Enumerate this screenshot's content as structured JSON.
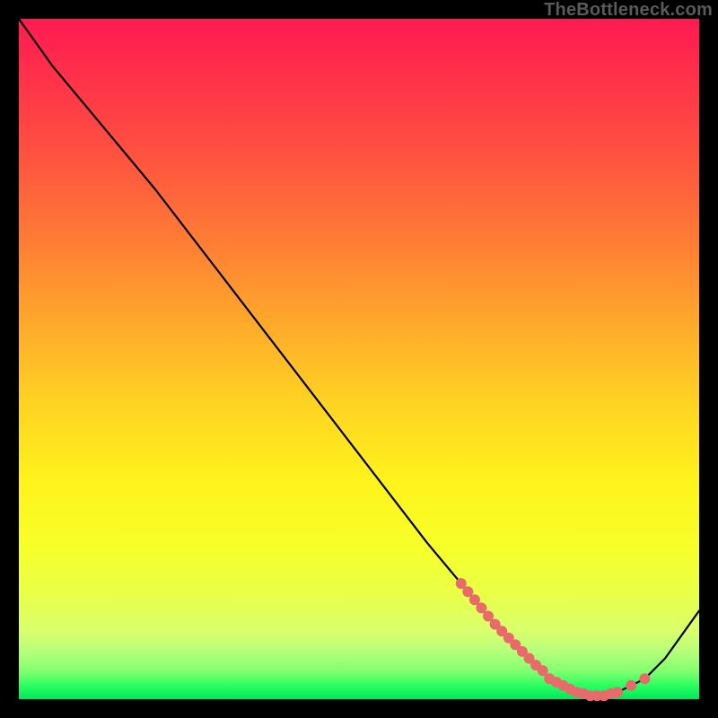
{
  "watermark": "TheBottleneck.com",
  "chart_data": {
    "type": "line",
    "title": "",
    "xlabel": "",
    "ylabel": "",
    "xlim": [
      0,
      100
    ],
    "ylim": [
      0,
      100
    ],
    "grid": false,
    "legend": false,
    "series": [
      {
        "name": "curve",
        "x": [
          0,
          5,
          10,
          20,
          30,
          40,
          50,
          60,
          65,
          70,
          75,
          78,
          80,
          82,
          84,
          86,
          88,
          90,
          92,
          95,
          100
        ],
        "y": [
          100,
          93,
          87,
          75,
          62,
          49,
          36,
          23,
          17,
          11,
          6,
          3,
          2,
          1,
          0.5,
          0.5,
          1,
          2,
          3,
          6,
          13
        ]
      }
    ],
    "markers": {
      "name": "highlight-dots",
      "color": "#e86a6a",
      "x": [
        65,
        66,
        67,
        68,
        69,
        70,
        71,
        72,
        73,
        74,
        75,
        76,
        77,
        78,
        79,
        80,
        81,
        82,
        83,
        84,
        85,
        86,
        87,
        88,
        90,
        92
      ],
      "y": [
        17,
        15.8,
        14.6,
        13.4,
        12.2,
        11,
        10,
        9,
        8,
        7,
        6,
        5,
        4.2,
        3,
        2.5,
        2,
        1.5,
        1,
        0.8,
        0.5,
        0.5,
        0.5,
        0.8,
        1,
        2,
        3
      ]
    },
    "background": {
      "type": "vertical-gradient",
      "stops": [
        {
          "pos": 0.0,
          "color": "#ff1a52"
        },
        {
          "pos": 0.5,
          "color": "#ffcf24"
        },
        {
          "pos": 0.78,
          "color": "#f6ff2a"
        },
        {
          "pos": 1.0,
          "color": "#00e85a"
        }
      ]
    }
  }
}
